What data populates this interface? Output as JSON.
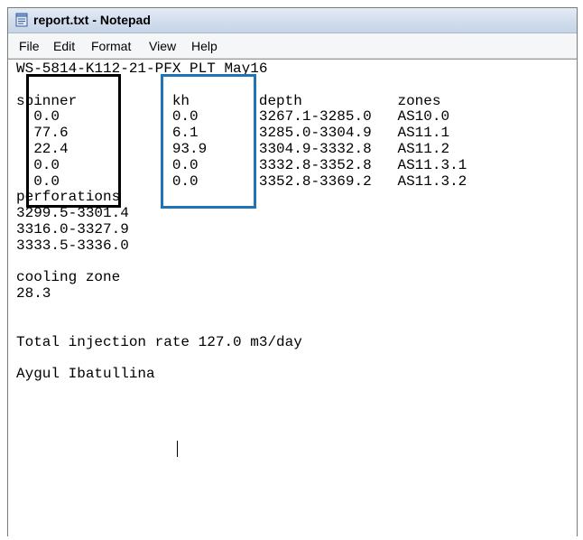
{
  "window": {
    "title": "report.txt - Notepad"
  },
  "menu": {
    "items": [
      "File",
      "Edit",
      "Format",
      "View",
      "Help"
    ]
  },
  "document": {
    "text": "WS-5814-K112-21-PFX PLT May16\n\nspinner           kh        depth           zones\n  0.0             0.0       3267.1-3285.0   AS10.0\n  77.6            6.1       3285.0-3304.9   AS11.1\n  22.4            93.9      3304.9-3332.8   AS11.2\n  0.0             0.0       3332.8-3352.8   AS11.3.1\n  0.0             0.0       3352.8-3369.2   AS11.3.2\nperforations\n3299.5-3301.4\n3316.0-3327.9\n3333.5-3336.0\n\ncooling zone\n28.3\n\n\nTotal injection rate 127.0 m3/day\n\nAygul Ibatullina"
  },
  "annotations": {
    "spinner_box_color": "#000000",
    "kh_box_color": "#1f73b8"
  },
  "colors": {
    "titlebar": "#d3deee",
    "menubar": "#f5f6f7",
    "editor_background": "#ffffff"
  },
  "icons": {
    "app": "notepad-icon"
  }
}
